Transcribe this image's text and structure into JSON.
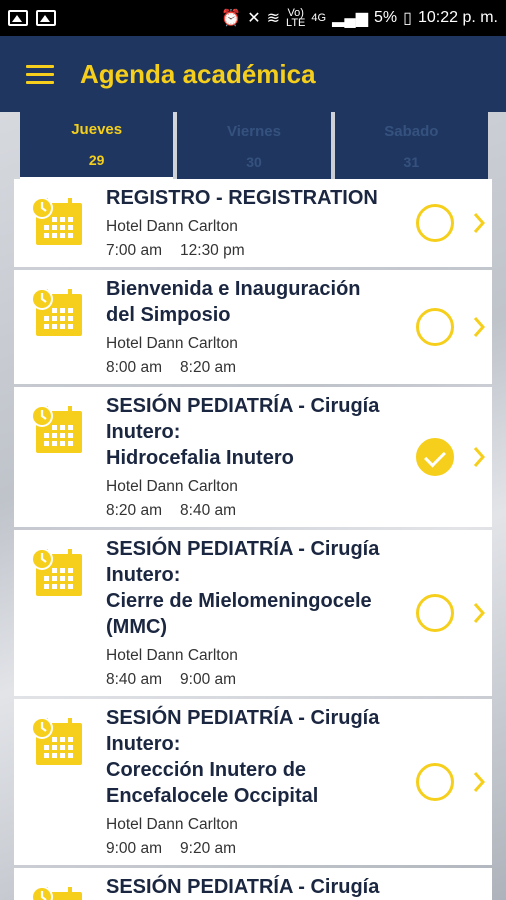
{
  "status_bar": {
    "network": "4G",
    "volte_top": "Vo)",
    "volte_bottom": "LTE",
    "battery": "5%",
    "time": "10:22 p. m."
  },
  "app_bar": {
    "title": "Agenda académica",
    "menu_icon": "hamburger-icon"
  },
  "tabs": [
    {
      "day": "Jueves",
      "num": "29",
      "active": true
    },
    {
      "day": "Viernes",
      "num": "30",
      "active": false
    },
    {
      "day": "Sabado",
      "num": "31",
      "active": false
    }
  ],
  "events": [
    {
      "title": "REGISTRO - REGISTRATION",
      "venue": "Hotel Dann Carlton",
      "start": "7:00 am",
      "end": "12:30 pm",
      "selected": false
    },
    {
      "title": "Bienvenida e Inauguración\ndel Simposio",
      "venue": "Hotel Dann Carlton",
      "start": "8:00 am",
      "end": "8:20 am",
      "selected": false
    },
    {
      "title": "SESIÓN PEDIATRÍA - Cirugía\nInutero:\nHidrocefalia Inutero",
      "venue": "Hotel Dann Carlton",
      "start": "8:20 am",
      "end": "8:40 am",
      "selected": true
    },
    {
      "title": "SESIÓN PEDIATRÍA - Cirugía\nInutero:\nCierre de Mielomeningocele\n(MMC)",
      "venue": "Hotel Dann Carlton",
      "start": "8:40 am",
      "end": "9:00 am",
      "selected": false
    },
    {
      "title": "SESIÓN PEDIATRÍA - Cirugía\nInutero:\nCorección Inutero de\nEncefalocele Occipital",
      "venue": "Hotel Dann Carlton",
      "start": "9:00 am",
      "end": "9:20 am",
      "selected": false
    },
    {
      "title": "SESIÓN PEDIATRÍA - Cirugía\nInutero:",
      "venue": "",
      "start": "",
      "end": "",
      "selected": false
    }
  ],
  "colors": {
    "primary": "#1f3760",
    "accent": "#f5cf1b"
  }
}
